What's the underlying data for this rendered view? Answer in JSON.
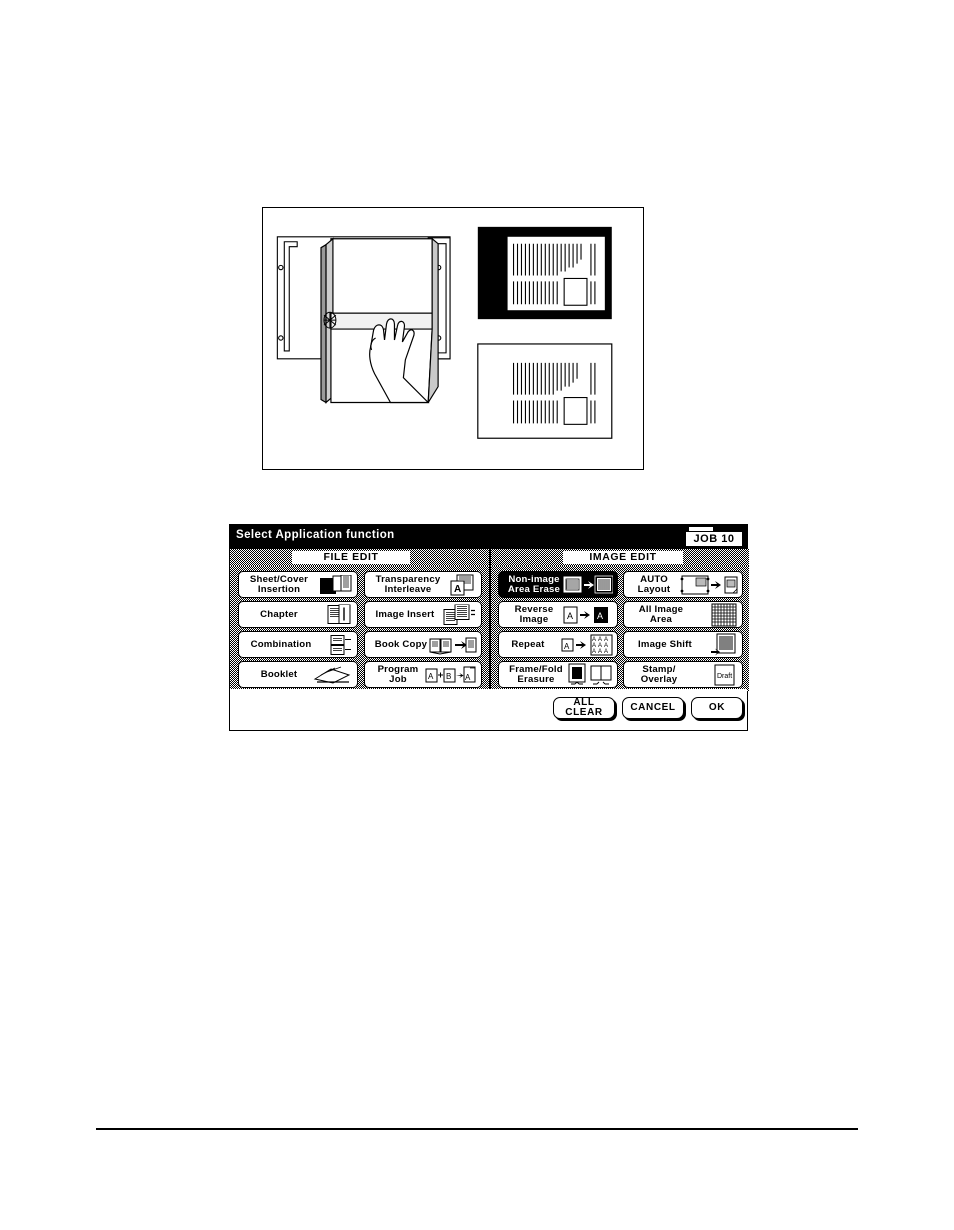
{
  "page": {
    "has_footer_rule": true
  },
  "illustration": {
    "name": "book-on-platen-with-non-image-area-erase-samples",
    "caption": "",
    "parts": [
      {
        "name": "platen-glass",
        "label": ""
      },
      {
        "name": "open-book",
        "label": ""
      },
      {
        "name": "hand",
        "label": ""
      },
      {
        "name": "sample-with-black-border",
        "label": ""
      },
      {
        "name": "sample-without-black-border",
        "label": ""
      }
    ]
  },
  "panel": {
    "title": "Select Application function",
    "job": {
      "label": "JOB 10"
    },
    "tabs": [
      {
        "id": "file-edit",
        "label": "FILE EDIT"
      },
      {
        "id": "image-edit",
        "label": "IMAGE EDIT"
      }
    ],
    "columns": [
      {
        "id": "file-edit-col-1",
        "buttons": [
          {
            "id": "sheet-cover-insertion",
            "label": "Sheet/Cover\nInsertion",
            "state": "disabled",
            "icon": "sheet-cover-icon"
          },
          {
            "id": "chapter",
            "label": "Chapter",
            "state": "disabled",
            "icon": "chapter-icon"
          },
          {
            "id": "combination",
            "label": "Combination",
            "state": "disabled",
            "icon": "combination-icon"
          },
          {
            "id": "booklet",
            "label": "Booklet",
            "state": "disabled",
            "icon": "booklet-icon"
          }
        ]
      },
      {
        "id": "file-edit-col-2",
        "buttons": [
          {
            "id": "transparency-interleave",
            "label": "Transparency\nInterleave",
            "state": "normal",
            "icon": "transparency-icon"
          },
          {
            "id": "image-insert",
            "label": "Image Insert",
            "state": "disabled",
            "icon": "image-insert-icon"
          },
          {
            "id": "book-copy",
            "label": "Book Copy",
            "state": "normal",
            "icon": "book-copy-icon"
          },
          {
            "id": "program-job",
            "label": "Program\nJob",
            "state": "normal",
            "icon": "program-job-icon"
          }
        ]
      },
      {
        "id": "image-edit-col-1",
        "buttons": [
          {
            "id": "non-image-area-erase",
            "label": "Non-image\nArea Erase",
            "state": "selected",
            "icon": "non-image-area-erase-icon"
          },
          {
            "id": "reverse-image",
            "label": "Reverse\nImage",
            "state": "disabled",
            "icon": "reverse-image-icon"
          },
          {
            "id": "repeat",
            "label": "Repeat",
            "state": "normal",
            "icon": "repeat-icon"
          },
          {
            "id": "frame-fold-erasure",
            "label": "Frame/Fold\nErasure",
            "state": "normal",
            "icon": "frame-fold-icon"
          }
        ]
      },
      {
        "id": "image-edit-col-2",
        "buttons": [
          {
            "id": "auto-layout",
            "label": "AUTO\nLayout",
            "state": "normal",
            "icon": "auto-layout-icon"
          },
          {
            "id": "all-image-area",
            "label": "All Image\nArea",
            "state": "disabled",
            "icon": "all-image-area-icon"
          },
          {
            "id": "image-shift",
            "label": "Image Shift",
            "state": "normal",
            "icon": "image-shift-icon"
          },
          {
            "id": "stamp-overlay",
            "label": "Stamp/\nOverlay",
            "state": "normal",
            "icon": "stamp-overlay-icon",
            "icon_text": "Draft"
          }
        ]
      }
    ],
    "footer_buttons": [
      {
        "id": "all-clear",
        "label": "ALL\nCLEAR"
      },
      {
        "id": "cancel",
        "label": "CANCEL"
      },
      {
        "id": "ok",
        "label": "OK"
      }
    ]
  },
  "colors": {
    "ink": "#000000",
    "paper": "#ffffff",
    "selected_bg": "#000000",
    "selected_fg": "#ffffff"
  }
}
